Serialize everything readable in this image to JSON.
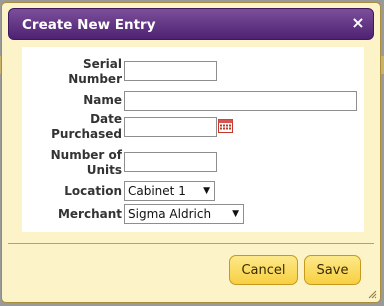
{
  "dialog": {
    "title": "Create New Entry",
    "close_glyph": "×"
  },
  "form": {
    "serial_number": {
      "label_line1": "Serial",
      "label_line2": "Number",
      "value": ""
    },
    "name": {
      "label": "Name",
      "value": ""
    },
    "date_purchased": {
      "label_line1": "Date",
      "label_line2": "Purchased",
      "value": "",
      "icon": "calendar-icon"
    },
    "number_of_units": {
      "label_line1": "Number of",
      "label_line2": "Units",
      "value": ""
    },
    "location": {
      "label": "Location",
      "selected": "Cabinet 1"
    },
    "merchant": {
      "label": "Merchant",
      "selected": "Sigma Aldrich"
    }
  },
  "buttons": {
    "cancel_label": "Cancel",
    "save_label": "Save"
  },
  "colors": {
    "titlebar": "#5e2f82",
    "dialog_bg": "#fdf3c9",
    "button": "#f9d85a"
  }
}
